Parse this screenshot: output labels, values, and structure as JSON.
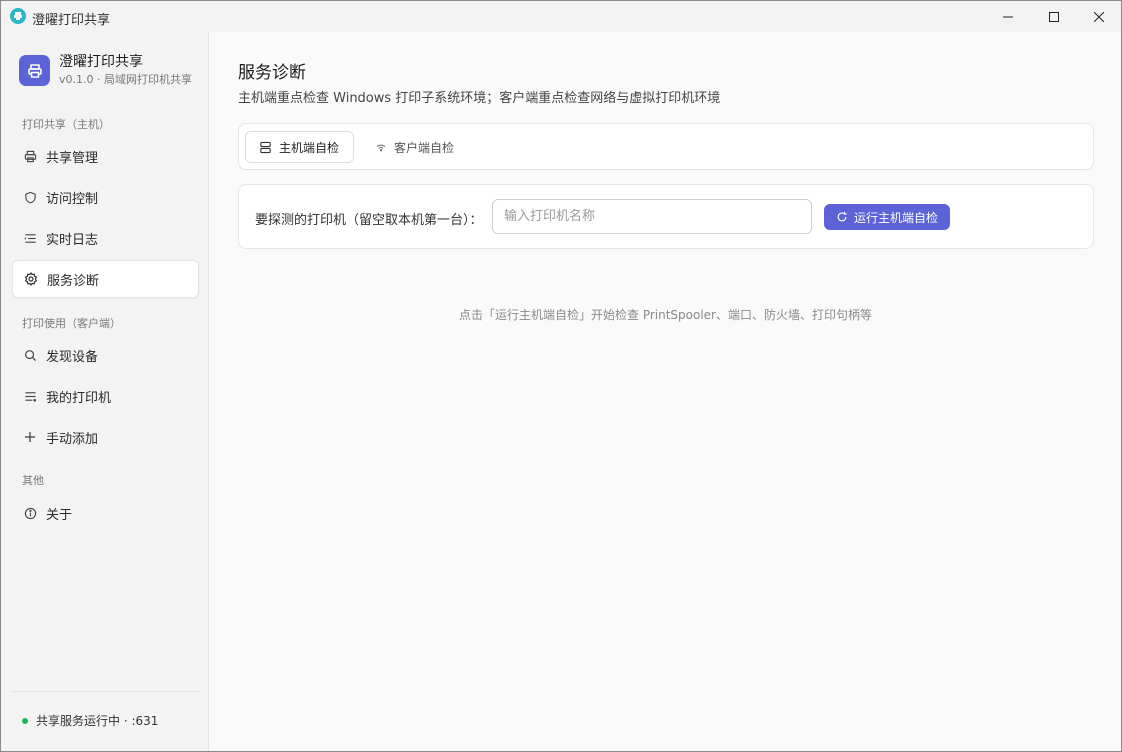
{
  "window": {
    "title": "澄曜打印共享"
  },
  "sidebar": {
    "brand": {
      "name": "澄曜打印共享",
      "subtitle": "v0.1.0 · 局域网打印机共享"
    },
    "sections": [
      {
        "label": "打印共享（主机）",
        "items": [
          {
            "label": "共享管理",
            "icon": "printer-icon"
          },
          {
            "label": "访问控制",
            "icon": "shield-icon"
          },
          {
            "label": "实时日志",
            "icon": "log-list-icon"
          },
          {
            "label": "服务诊断",
            "icon": "gear-icon",
            "active": true
          }
        ]
      },
      {
        "label": "打印使用（客户端）",
        "items": [
          {
            "label": "发现设备",
            "icon": "search-icon"
          },
          {
            "label": "我的打印机",
            "icon": "list-icon"
          },
          {
            "label": "手动添加",
            "icon": "plus-icon"
          }
        ]
      },
      {
        "label": "其他",
        "items": [
          {
            "label": "关于",
            "icon": "info-icon"
          }
        ]
      }
    ],
    "status": {
      "text": "共享服务运行中 · :631",
      "color": "#1fb35a"
    }
  },
  "main": {
    "title": "服务诊断",
    "subtitle": "主机端重点检查 Windows 打印子系统环境；客户端重点检查网络与虚拟打印机环境",
    "tabs": [
      {
        "label": "主机端自检",
        "icon": "server-icon",
        "active": true
      },
      {
        "label": "客户端自检",
        "icon": "wifi-icon",
        "active": false
      }
    ],
    "form": {
      "label": "要探测的打印机（留空取本机第一台）：",
      "input_value": "",
      "input_placeholder": "输入打印机名称",
      "run_button": "运行主机端自检"
    },
    "hint": "点击「运行主机端自检」开始检查 PrintSpooler、端口、防火墙、打印句柄等"
  },
  "colors": {
    "accent": "#5b63d6",
    "status_ok": "#1fb35a"
  }
}
